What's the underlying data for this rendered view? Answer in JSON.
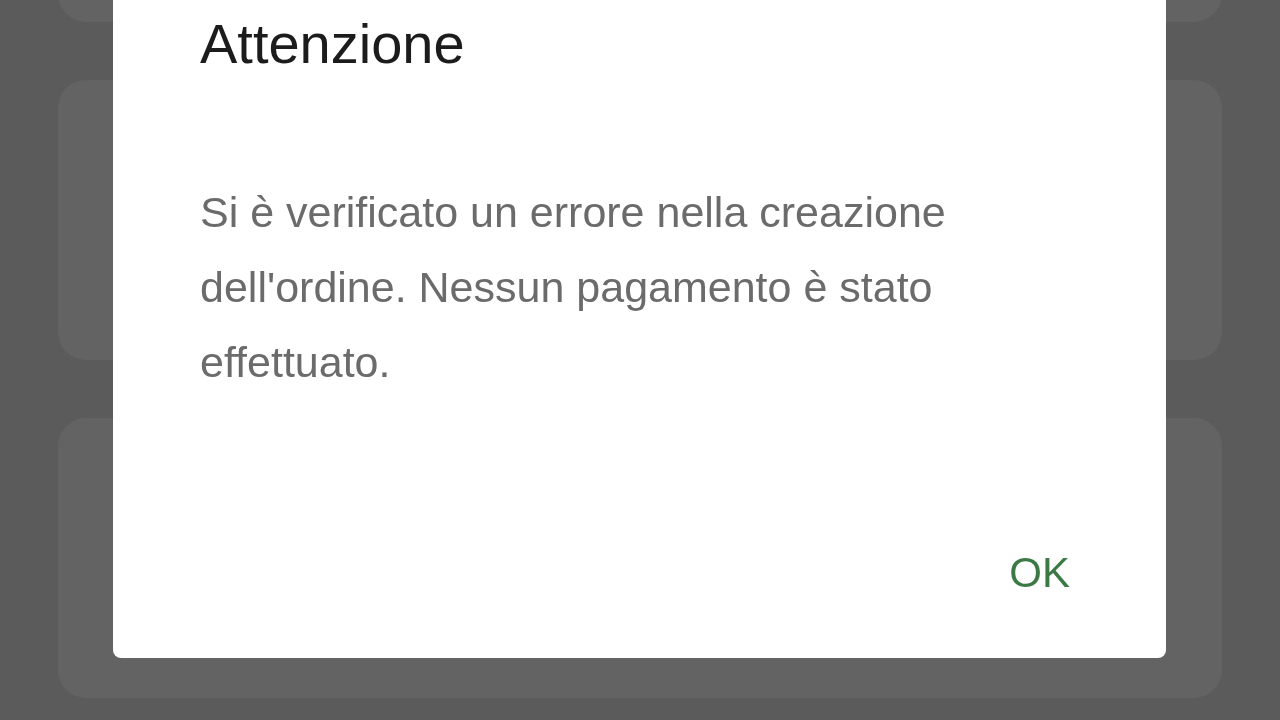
{
  "dialog": {
    "title": "Attenzione",
    "message": "Si è verificato un errore nella creazione dell'ordine. Nessun pagamento è stato effettuato.",
    "buttons": [
      "OK"
    ]
  }
}
